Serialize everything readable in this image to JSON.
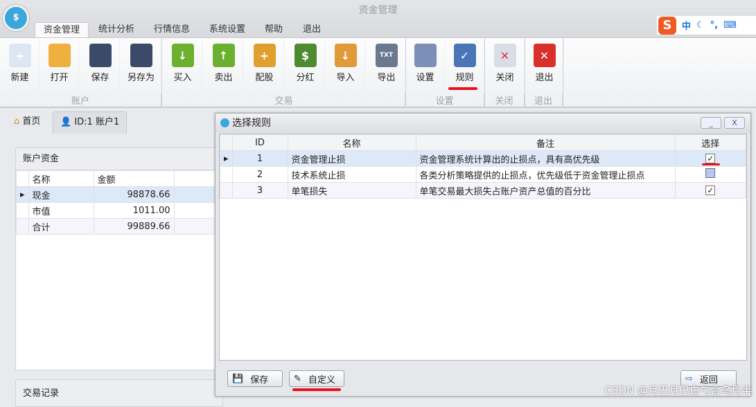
{
  "app": {
    "title": "资金管理"
  },
  "menu_tabs": [
    "资金管理",
    "统计分析",
    "行情信息",
    "系统设置",
    "帮助",
    "退出"
  ],
  "ime": {
    "mode": "中",
    "punct": "°,"
  },
  "ribbon": {
    "buttons": [
      {
        "label": "新建",
        "icon": "new-file-icon"
      },
      {
        "label": "打开",
        "icon": "open-folder-icon"
      },
      {
        "label": "保存",
        "icon": "save-icon"
      },
      {
        "label": "另存为",
        "icon": "save-as-icon"
      },
      {
        "label": "买入",
        "icon": "arrow-down-circle-icon"
      },
      {
        "label": "卖出",
        "icon": "arrow-up-circle-icon"
      },
      {
        "label": "配股",
        "icon": "database-add-icon"
      },
      {
        "label": "分红",
        "icon": "dollar-book-icon"
      },
      {
        "label": "导入",
        "icon": "import-icon"
      },
      {
        "label": "导出",
        "icon": "export-txt-icon"
      },
      {
        "label": "设置",
        "icon": "user-settings-icon"
      },
      {
        "label": "规则",
        "icon": "clipboard-check-icon"
      },
      {
        "label": "关闭",
        "icon": "close-window-icon"
      },
      {
        "label": "退出",
        "icon": "exit-icon"
      }
    ],
    "groups": [
      "账户",
      "交易",
      "设置",
      "关闭",
      "退出"
    ]
  },
  "doc_tabs": [
    "首页",
    "ID:1 账户1"
  ],
  "account_funds": {
    "title": "账户资金",
    "columns": [
      "名称",
      "金额"
    ],
    "rows": [
      [
        "现金",
        "98878.66"
      ],
      [
        "市值",
        "1011.00"
      ],
      [
        "合计",
        "99889.66"
      ]
    ]
  },
  "trade_records": {
    "title": "交易记录"
  },
  "dialog": {
    "title": "选择规则",
    "minimize": "_",
    "close": "X",
    "columns": [
      "ID",
      "名称",
      "备注",
      "选择"
    ],
    "rows": [
      {
        "id": "1",
        "name": "资金管理止损",
        "note": "资金管理系统计算出的止损点，具有高优先级",
        "checked": true
      },
      {
        "id": "2",
        "name": "技术系统止损",
        "note": "各类分析策略提供的止损点，优先级低于资金管理止损点",
        "checked": false
      },
      {
        "id": "3",
        "name": "单笔损失",
        "note": "单笔交易最大损失占账户资产总值的百分比",
        "checked": true
      }
    ],
    "save": "保存",
    "custom": "自定义",
    "back": "返回"
  },
  "watermark": "CSDN @月巴月巴白勺合鸟月半",
  "colors": {
    "accent": "#3aa7dc",
    "highlight": "#e8121d",
    "selected_row": "#dde8f8"
  }
}
